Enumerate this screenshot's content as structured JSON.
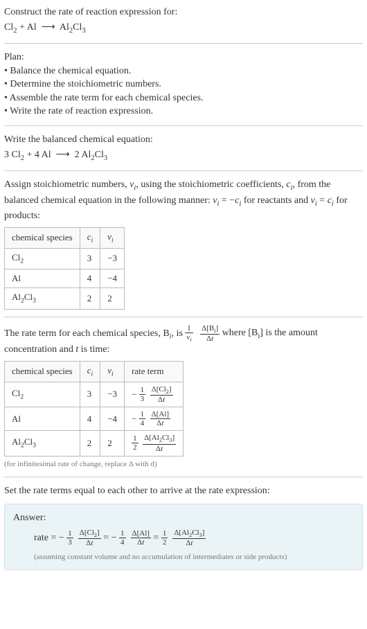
{
  "prompt": {
    "title": "Construct the rate of reaction expression for:",
    "equation_html": "Cl<span class='sub'>2</span> + Al &nbsp;⟶&nbsp; Al<span class='sub'>2</span>Cl<span class='sub'>3</span>"
  },
  "plan": {
    "heading": "Plan:",
    "items": [
      "Balance the chemical equation.",
      "Determine the stoichiometric numbers.",
      "Assemble the rate term for each chemical species.",
      "Write the rate of reaction expression."
    ]
  },
  "balanced": {
    "heading": "Write the balanced chemical equation:",
    "equation_html": "3 Cl<span class='sub'>2</span> + 4 Al &nbsp;⟶&nbsp; 2 Al<span class='sub'>2</span>Cl<span class='sub'>3</span>"
  },
  "stoich": {
    "intro_html": "Assign stoichiometric numbers, <i>ν<span class='sub'>i</span></i>, using the stoichiometric coefficients, <i>c<span class='sub'>i</span></i>, from the balanced chemical equation in the following manner: <i>ν<span class='sub'>i</span></i> = −<i>c<span class='sub'>i</span></i> for reactants and <i>ν<span class='sub'>i</span></i> = <i>c<span class='sub'>i</span></i> for products:",
    "headers": {
      "species": "chemical species",
      "ci_html": "<i>c<span class='sub'>i</span></i>",
      "vi_html": "<i>ν<span class='sub'>i</span></i>"
    },
    "rows": [
      {
        "species_html": "Cl<span class='sub'>2</span>",
        "ci": "3",
        "vi": "−3"
      },
      {
        "species_html": "Al",
        "ci": "4",
        "vi": "−4"
      },
      {
        "species_html": "Al<span class='sub'>2</span>Cl<span class='sub'>3</span>",
        "ci": "2",
        "vi": "2"
      }
    ]
  },
  "rateterm": {
    "intro_pre": "The rate term for each chemical species, B",
    "intro_mid": ", is ",
    "frac1_num_html": "1",
    "frac1_den_html": "<i>ν<span class='sub'>i</span></i>",
    "frac2_num_html": "Δ[B<span class='sub'>i</span>]",
    "frac2_den_html": "Δ<i>t</i>",
    "intro_post_html": " where [B<span class='sub'>i</span>] is the amount concentration and <i>t</i> is time:",
    "headers": {
      "species": "chemical species",
      "ci_html": "<i>c<span class='sub'>i</span></i>",
      "vi_html": "<i>ν<span class='sub'>i</span></i>",
      "rate": "rate term"
    },
    "rows": [
      {
        "species_html": "Cl<span class='sub'>2</span>",
        "ci": "3",
        "vi": "−3",
        "sign": "−",
        "coef_num": "1",
        "coef_den": "3",
        "dnum_html": "Δ[Cl<span class='sub'>2</span>]",
        "dden_html": "Δ<i>t</i>"
      },
      {
        "species_html": "Al",
        "ci": "4",
        "vi": "−4",
        "sign": "−",
        "coef_num": "1",
        "coef_den": "4",
        "dnum_html": "Δ[Al]",
        "dden_html": "Δ<i>t</i>"
      },
      {
        "species_html": "Al<span class='sub'>2</span>Cl<span class='sub'>3</span>",
        "ci": "2",
        "vi": "2",
        "sign": "",
        "coef_num": "1",
        "coef_den": "2",
        "dnum_html": "Δ[Al<span class='sub'>2</span>Cl<span class='sub'>3</span>]",
        "dden_html": "Δ<i>t</i>"
      }
    ],
    "note": "(for infinitesimal rate of change, replace Δ with d)"
  },
  "final": {
    "heading": "Set the rate terms equal to each other to arrive at the rate expression:"
  },
  "answer": {
    "label": "Answer:",
    "rate_label": "rate = ",
    "terms": [
      {
        "sign": "−",
        "coef_num": "1",
        "coef_den": "3",
        "dnum_html": "Δ[Cl<span class='sub'>2</span>]",
        "dden_html": "Δ<i>t</i>"
      },
      {
        "sign": "−",
        "coef_num": "1",
        "coef_den": "4",
        "dnum_html": "Δ[Al]",
        "dden_html": "Δ<i>t</i>"
      },
      {
        "sign": "",
        "coef_num": "1",
        "coef_den": "2",
        "dnum_html": "Δ[Al<span class='sub'>2</span>Cl<span class='sub'>3</span>]",
        "dden_html": "Δ<i>t</i>"
      }
    ],
    "note": "(assuming constant volume and no accumulation of intermediates or side products)"
  }
}
